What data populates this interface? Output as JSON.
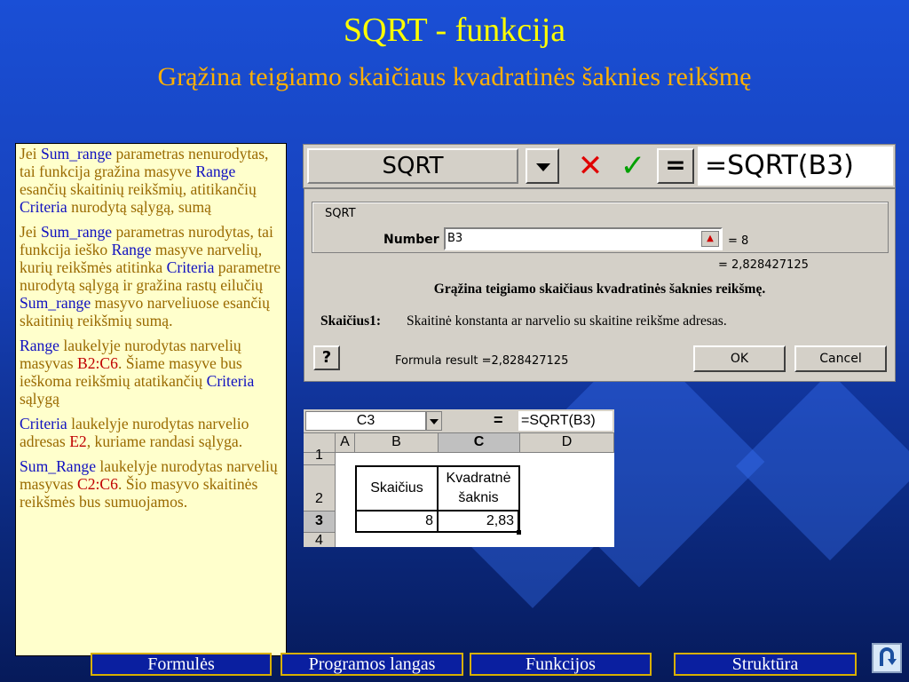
{
  "slide": {
    "title": "SQRT - funkcija",
    "subtitle": "Grąžina teigiamo skaičiaus kvadratinės šaknies reikšmę"
  },
  "notes": [
    [
      {
        "t": "Jei ",
        "c": "n"
      },
      {
        "t": "Sum_range",
        "c": "k"
      },
      {
        "t": " parametras nenurodytas, tai funkcija gražina masyve ",
        "c": "n"
      },
      {
        "t": "Range",
        "c": "k"
      },
      {
        "t": " esančių skaitinių reikšmių, atitikančių ",
        "c": "n"
      },
      {
        "t": "Criteria",
        "c": "k"
      },
      {
        "t": " nurodytą sąlygą, sumą",
        "c": "n"
      }
    ],
    [
      {
        "t": "Jei ",
        "c": "n"
      },
      {
        "t": "Sum_range",
        "c": "k"
      },
      {
        "t": " parametras nurodytas, tai funkcija ieško ",
        "c": "n"
      },
      {
        "t": "Range",
        "c": "k"
      },
      {
        "t": " masyve narvelių, kurių reikšmės atitinka ",
        "c": "n"
      },
      {
        "t": "Criteria",
        "c": "k"
      },
      {
        "t": " parametre nurodytą sąlygą ir gražina rastų eilučių ",
        "c": "n"
      },
      {
        "t": "Sum_range",
        "c": "k"
      },
      {
        "t": " masyvo narveliuose esančių skaitinių reikšmių sumą.",
        "c": "n"
      }
    ],
    [
      {
        "t": "Range",
        "c": "k"
      },
      {
        "t": " laukelyje nurodytas narvelių masyvas ",
        "c": "n"
      },
      {
        "t": "B2:C6",
        "c": "r"
      },
      {
        "t": ". Šiame masyve bus ieškoma reikšmių atatikančių ",
        "c": "n"
      },
      {
        "t": "Criteria",
        "c": "k"
      },
      {
        "t": " sąlygą",
        "c": "n"
      }
    ],
    [
      {
        "t": "Criteria",
        "c": "k"
      },
      {
        "t": " laukelyje nurodytas narvelio adresas ",
        "c": "n"
      },
      {
        "t": "E2",
        "c": "r"
      },
      {
        "t": ", kuriame randasi sąlyga.",
        "c": "n"
      }
    ],
    [
      {
        "t": "Sum_Range",
        "c": "k"
      },
      {
        "t": " laukelyje nurodytas narvelių masyvas ",
        "c": "n"
      },
      {
        "t": "C2:C6",
        "c": "r"
      },
      {
        "t": ". Šio masyvo skaitinės reikšmės bus sumuojamos.",
        "c": "n"
      }
    ]
  ],
  "formula_bar": {
    "name_box": "SQRT",
    "cancel": "✕",
    "enter": "✓",
    "equals": "=",
    "formula": "=SQRT(B3)"
  },
  "dialog": {
    "group_label": "SQRT",
    "number_label": "Number",
    "number_value": "B3",
    "number_result": "= 8",
    "result_line": "= 2,828427125",
    "description": "Grąžina teigiamo skaičiaus kvadratinės šaknies reikšmę.",
    "arg_label": "Skaičius1:",
    "arg_description": "Skaitinė konstanta ar narvelio su skaitine reikšme adresas.",
    "formula_result": "Formula result =2,828427125",
    "ok": "OK",
    "cancel": "Cancel",
    "help": "?"
  },
  "sheet": {
    "name_box": "C3",
    "equals": "=",
    "formula": "=SQRT(B3)",
    "columns": [
      "A",
      "B",
      "C",
      "D"
    ],
    "rows": [
      "1",
      "2",
      "3",
      "4"
    ],
    "b2": "Skaičius",
    "c2_line1": "Kvadratnė",
    "c2_line2": "šaknis",
    "b3": "8",
    "c3": "2,83"
  },
  "nav": {
    "buttons": [
      "Formulės",
      "Programos langas",
      "Funkcijos",
      "Struktūra"
    ],
    "return_icon": "u-turn-return-icon"
  },
  "colors": {
    "title": "#ffff00",
    "subtitle": "#ffb000",
    "notes_text": "#9a6a00",
    "keyword": "#1010c0",
    "range": "#c00000"
  }
}
